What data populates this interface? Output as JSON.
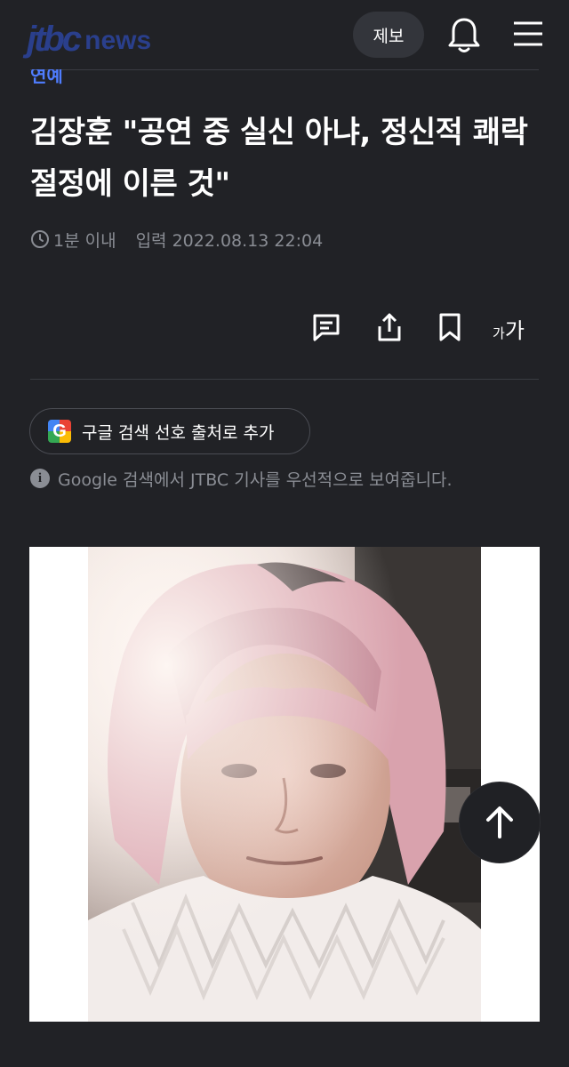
{
  "header": {
    "logo_main": "jtbc",
    "logo_sub": "news",
    "report_label": "제보",
    "icons": {
      "notifications": "bell-icon",
      "menu": "hamburger-menu-icon"
    },
    "colors": {
      "brand": "#2a3f8c",
      "background": "#212226",
      "category": "#4f7dff"
    }
  },
  "article": {
    "category": "연예",
    "title": "김장훈 \"공연 중 실신 아냐, 정신적 쾌락 절정에 이른 것\"",
    "read_time": "1분 이내",
    "published_label": "입력 2022.08.13 22:04"
  },
  "toolbar": {
    "icons": [
      "comment-icon",
      "share-icon",
      "bookmark-icon"
    ],
    "font_small": "가",
    "font_large": "가"
  },
  "google": {
    "chip_label": "구글 검색 선호 출처로 추가",
    "info_text": "Google 검색에서 JTBC 기사를 우선적으로 보여줍니다.",
    "info_icon_glyph": "i"
  },
  "photo": {
    "icon": "photo-image"
  },
  "scroll_top": {
    "icon": "arrow-up-icon"
  }
}
